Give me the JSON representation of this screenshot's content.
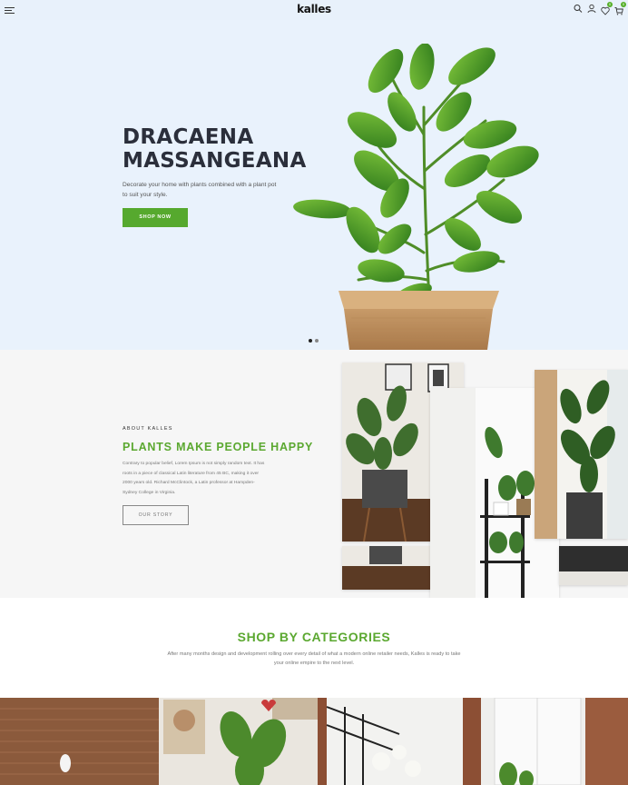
{
  "header": {
    "logo": "kalles",
    "wishlist_count": "0",
    "cart_count": "0"
  },
  "hero": {
    "title_line1": "DRACAENA",
    "title_line2": "MASSANGEANA",
    "description": "Decorate your home with plants combined with a plant pot to suit your style.",
    "button_label": "SHOP NOW",
    "slides": 2,
    "active_slide": 1
  },
  "about": {
    "kicker": "ABOUT KALLES",
    "title": "PLANTS MAKE PEOPLE HAPPY",
    "text": "Contrary to popular belief, Lorem Ipsum is not simply random text. It has roots in a piece of classical Latin literature from 45 BC, making it over 2000 years old. Richard McClintock, a Latin professor at Hampden-Sydney College in Virginia.",
    "button_label": "OUR STORY"
  },
  "categories": {
    "title": "SHOP BY CATEGORIES",
    "description": "After many months design and development rolling over every detail of what a modern online retailer needs, Kalles is ready to take your online empire to the next level."
  },
  "colors": {
    "accent": "#56a92e",
    "hero_bg": "#e9f2fc",
    "about_bg": "#f6f6f6"
  }
}
